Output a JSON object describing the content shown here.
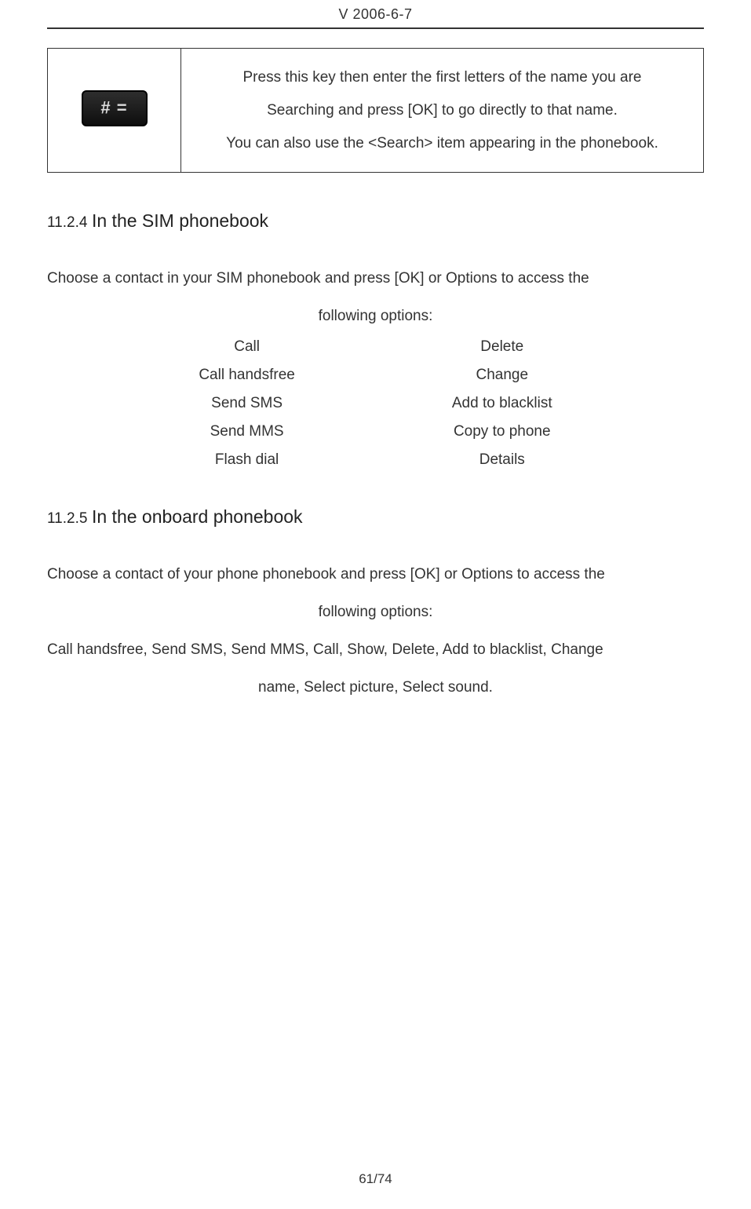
{
  "header": {
    "version": "V 2006-6-7"
  },
  "topTable": {
    "keyLabel": "# =",
    "lines": [
      "Press this key then enter the first letters of the name you are",
      "Searching and press [OK] to go directly to that name.",
      "You can also use the <Search> item appearing in the phonebook."
    ]
  },
  "section1": {
    "num": "11.2.4",
    "title": "In the SIM phonebook",
    "intro1": "Choose a contact in your SIM phonebook and press [OK] or Options to access the",
    "intro2": "following options:",
    "left": [
      "Call",
      "Call handsfree",
      "Send SMS",
      "Send MMS",
      "Flash dial"
    ],
    "right": [
      "Delete",
      "Change",
      "Add to blacklist",
      "Copy to phone",
      "Details"
    ]
  },
  "section2": {
    "num": "11.2.5",
    "title": "In the onboard phonebook",
    "p1": "Choose a contact of your phone phonebook and press [OK] or Options to access the",
    "p2": "following options:",
    "p3": "Call handsfree, Send SMS, Send MMS, Call, Show, Delete, Add to blacklist, Change",
    "p4": "name, Select picture, Select sound."
  },
  "footer": {
    "page": "61/74"
  }
}
